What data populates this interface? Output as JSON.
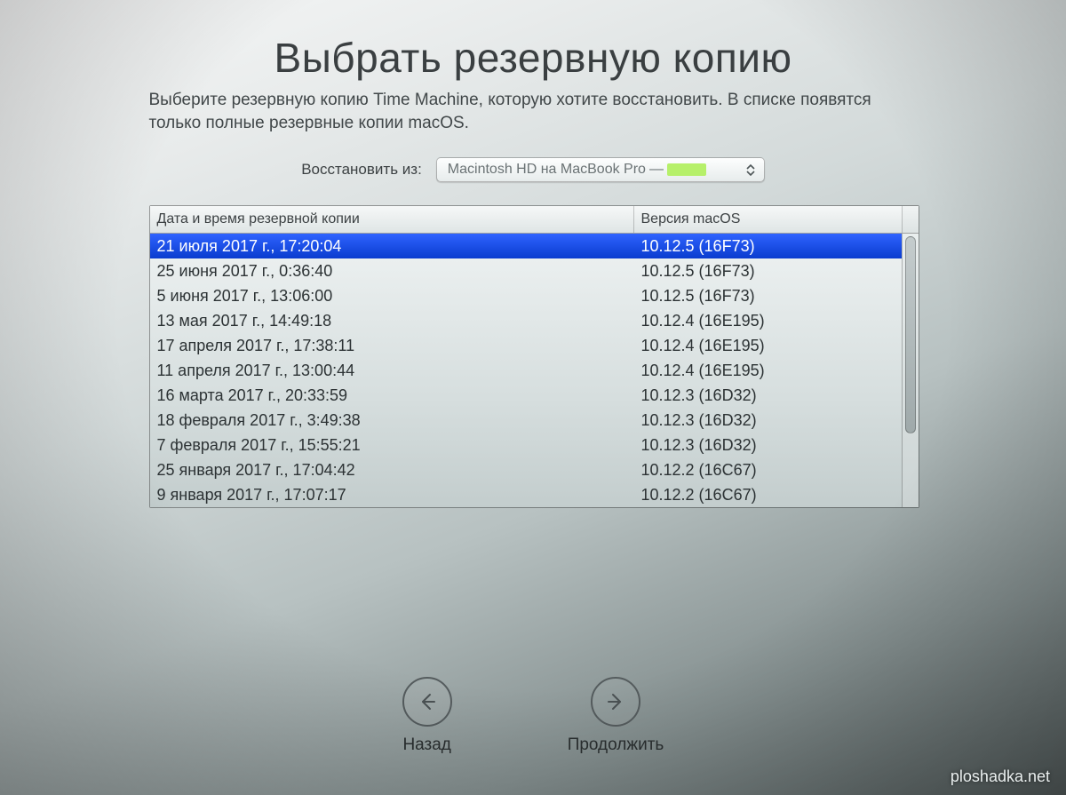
{
  "header": {
    "title": "Выбрать резервную копию",
    "subtitle": "Выберите резервную копию Time Machine, которую хотите восстановить. В списке появятся только полные резервные копии macOS."
  },
  "restore": {
    "label": "Восстановить из:",
    "source": "Macintosh HD на MacBook Pro"
  },
  "table": {
    "col_date": "Дата и время резервной копии",
    "col_version": "Версия macOS",
    "selected_index": 0,
    "rows": [
      {
        "date": "21 июля 2017 г., 17:20:04",
        "version": "10.12.5 (16F73)"
      },
      {
        "date": "25 июня 2017 г., 0:36:40",
        "version": "10.12.5 (16F73)"
      },
      {
        "date": "5 июня 2017 г., 13:06:00",
        "version": "10.12.5 (16F73)"
      },
      {
        "date": "13 мая 2017 г., 14:49:18",
        "version": "10.12.4 (16E195)"
      },
      {
        "date": "17 апреля 2017 г., 17:38:11",
        "version": "10.12.4 (16E195)"
      },
      {
        "date": "11 апреля 2017 г., 13:00:44",
        "version": "10.12.4 (16E195)"
      },
      {
        "date": "16 марта 2017 г., 20:33:59",
        "version": "10.12.3 (16D32)"
      },
      {
        "date": "18 февраля 2017 г., 3:49:38",
        "version": "10.12.3 (16D32)"
      },
      {
        "date": "7 февраля 2017 г., 15:55:21",
        "version": "10.12.3 (16D32)"
      },
      {
        "date": "25 января 2017 г., 17:04:42",
        "version": "10.12.2 (16C67)"
      },
      {
        "date": "9 января 2017 г., 17:07:17",
        "version": "10.12.2 (16C67)"
      }
    ]
  },
  "nav": {
    "back": "Назад",
    "continue": "Продолжить"
  },
  "watermark": "ploshadka.net"
}
